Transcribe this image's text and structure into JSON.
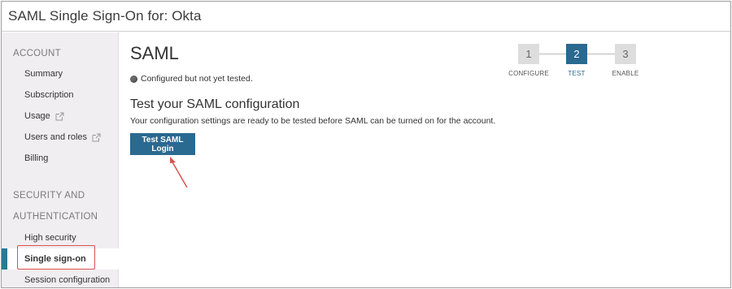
{
  "window": {
    "title": "SAML Single Sign-On for: Okta"
  },
  "sidebar": {
    "sections": [
      {
        "label": "ACCOUNT"
      },
      {
        "label_line1": "SECURITY AND",
        "label_line2": "AUTHENTICATION"
      }
    ],
    "account_items": [
      {
        "label": "Summary"
      },
      {
        "label": "Subscription"
      },
      {
        "label": "Usage",
        "icon": "external-link-icon"
      },
      {
        "label": "Users and roles",
        "icon": "external-link-icon"
      },
      {
        "label": "Billing"
      }
    ],
    "security_items": [
      {
        "label": "High security"
      },
      {
        "label": "Single sign-on",
        "active": true
      },
      {
        "label": "Session configuration"
      }
    ]
  },
  "main": {
    "heading": "SAML",
    "status_text": "Configured but not yet tested.",
    "subheading": "Test your SAML configuration",
    "description": "Your configuration settings are ready to be tested before SAML can be turned on for the account.",
    "test_button_label": "Test SAML Login"
  },
  "steps": [
    {
      "number": "1",
      "label": "CONFIGURE",
      "active": false
    },
    {
      "number": "2",
      "label": "TEST",
      "active": true
    },
    {
      "number": "3",
      "label": "ENABLE",
      "active": false
    }
  ],
  "colors": {
    "accent": "#2a6990",
    "sidebar_bg": "#f1eef1",
    "active_marker": "#2b7b8f",
    "annotation": "#d9534f"
  }
}
